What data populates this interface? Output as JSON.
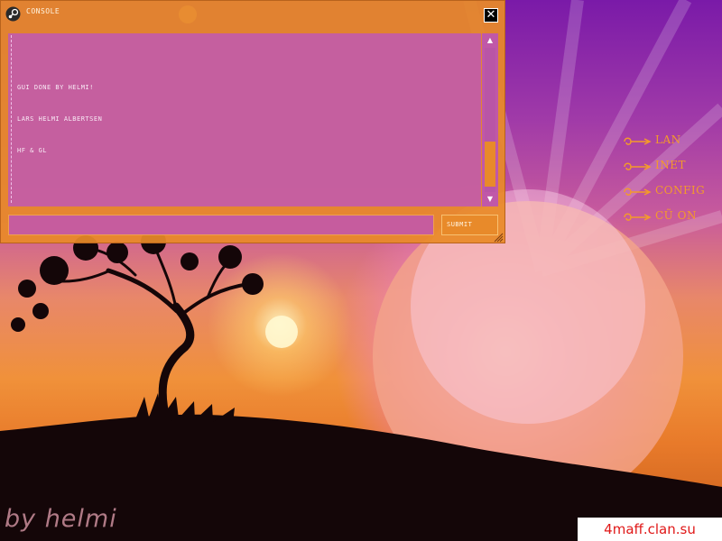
{
  "console": {
    "title": "CONSOLE",
    "close_label": "✕",
    "lines": [
      "GUI DONE BY HELMI!",
      "LARS HELMI ALBERTSEN",
      "HF & GL"
    ],
    "scroll_up": "▲",
    "scroll_down": "▼",
    "input_value": "",
    "submit_label": "SUBMIT"
  },
  "menu": {
    "items": [
      {
        "label": "LAN"
      },
      {
        "label": "INET"
      },
      {
        "label": "CONFIG"
      },
      {
        "label": "CŨ ON"
      }
    ]
  },
  "brand": "by helmi",
  "watermark": "4maff.clan.su",
  "icons": {
    "console": "steam-icon",
    "close": "close-icon",
    "menu_ornament": "scroll-ornament-icon",
    "resize": "resize-grip-icon"
  },
  "colors": {
    "window_orange": "#e88a2a",
    "panel_pink": "#c35ca8",
    "menu_text": "#f49a2a",
    "watermark_red": "#e01818"
  }
}
